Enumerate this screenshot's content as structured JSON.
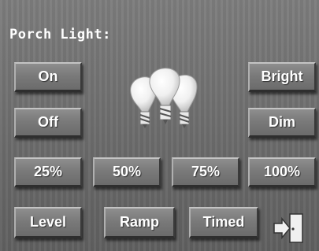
{
  "screen": {
    "title": "Porch Light:"
  },
  "buttons": {
    "on": "On",
    "off": "Off",
    "bright": "Bright",
    "dim": "Dim",
    "pct25": "25%",
    "pct50": "50%",
    "pct75": "75%",
    "pct100": "100%",
    "level": "Level",
    "ramp": "Ramp",
    "timed": "Timed"
  },
  "icons": {
    "device": "light-bulbs-icon",
    "exit": "exit-door-icon"
  },
  "colors": {
    "panel": "#707070",
    "text": "#ffffff",
    "exit_icon": "#f0f0f0"
  }
}
